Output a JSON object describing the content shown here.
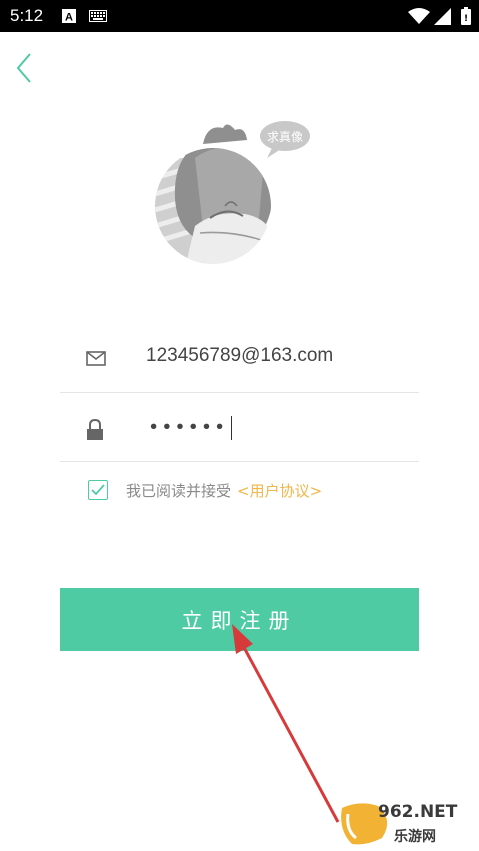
{
  "status_bar": {
    "time": "5:12",
    "icons": [
      "a-icon",
      "keyboard-icon",
      "wifi-icon",
      "cell-signal-icon",
      "battery-icon"
    ]
  },
  "avatar": {
    "speech_bubble": "求真像"
  },
  "form": {
    "email_value": "123456789@163.com",
    "password_mask": "••••••",
    "agree_text": "我已阅读并接受",
    "agreement_link": "<用户协议>",
    "agree_checked": true
  },
  "register_button_label": "立即注册",
  "watermark": {
    "brand": "962.NET",
    "sub": "乐游网"
  },
  "colors": {
    "accent": "#4ecba3",
    "link": "#f0b64a",
    "annotation_arrow": "#d63a3a"
  }
}
